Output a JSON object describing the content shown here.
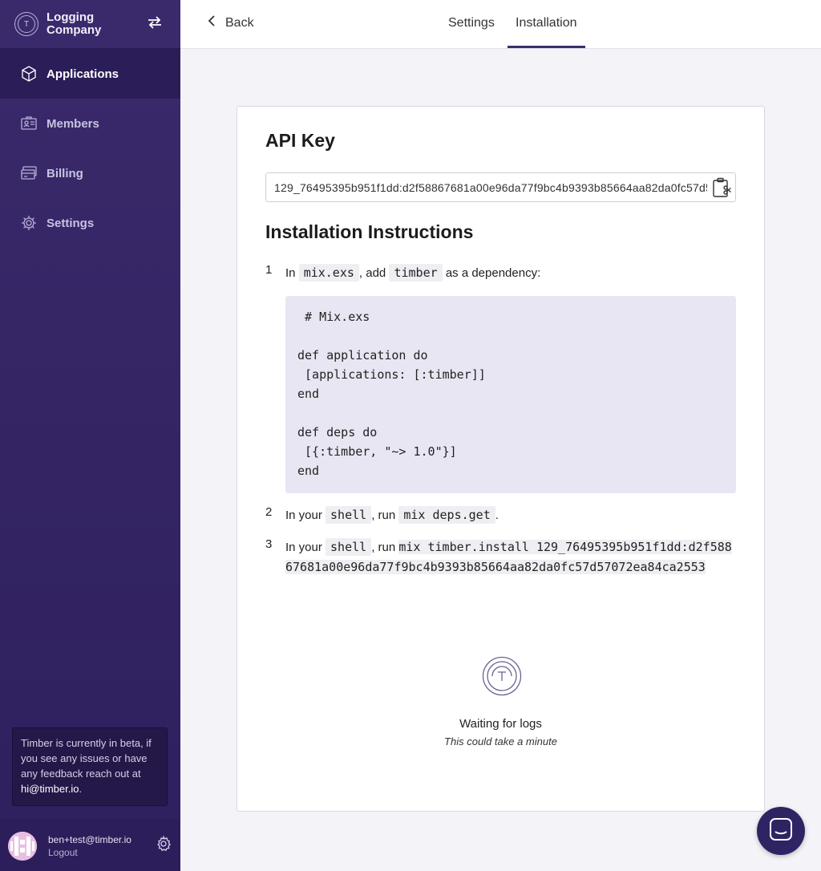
{
  "sidebar": {
    "org_name": "Logging Company",
    "items": [
      {
        "label": "Applications",
        "icon": "cube-icon"
      },
      {
        "label": "Members",
        "icon": "id-card-icon"
      },
      {
        "label": "Billing",
        "icon": "credit-card-icon"
      },
      {
        "label": "Settings",
        "icon": "gear-icon"
      }
    ],
    "beta_notice": "Timber is currently in beta, if you see any issues or have any feedback reach out at",
    "beta_email": "hi@timber.io",
    "beta_suffix": ".",
    "user_email": "ben+test@timber.io",
    "logout_label": "Logout"
  },
  "topbar": {
    "back_label": "Back",
    "tabs": [
      {
        "label": "Settings"
      },
      {
        "label": "Installation",
        "active": true
      }
    ]
  },
  "main": {
    "api_key_title": "API Key",
    "api_key_value": "129_76495395b951f1dd:d2f58867681a00e96da77f9bc4b9393b85664aa82da0fc57d57072ea84ca2553",
    "instructions_title": "Installation Instructions",
    "step1": {
      "num": "1",
      "pre": "In",
      "file": "mix.exs",
      "mid": ", add",
      "pkg": "timber",
      "post": "as a dependency:"
    },
    "code": " # Mix.exs\n\ndef application do\n [applications: [:timber]]\nend\n\ndef deps do\n [{:timber, \"~> 1.0\"}]\nend",
    "step2": {
      "num": "2",
      "pre": "In your",
      "shell": "shell",
      "mid": ", run",
      "cmd": "mix deps.get",
      "post": "."
    },
    "step3": {
      "num": "3",
      "pre": "In your",
      "shell": "shell",
      "mid": ", run",
      "cmd": "mix timber.install 129_76495395b951f1dd:d2f58867681a00e96da77f9bc4b9393b85664aa82da0fc57d57072ea84ca2553"
    },
    "waiting_title": "Waiting for logs",
    "waiting_sub": "This could take a minute"
  },
  "colors": {
    "sidebar": "#2e1f5e",
    "accent": "#3d2e6c",
    "code_bg": "#e8e6f2"
  }
}
